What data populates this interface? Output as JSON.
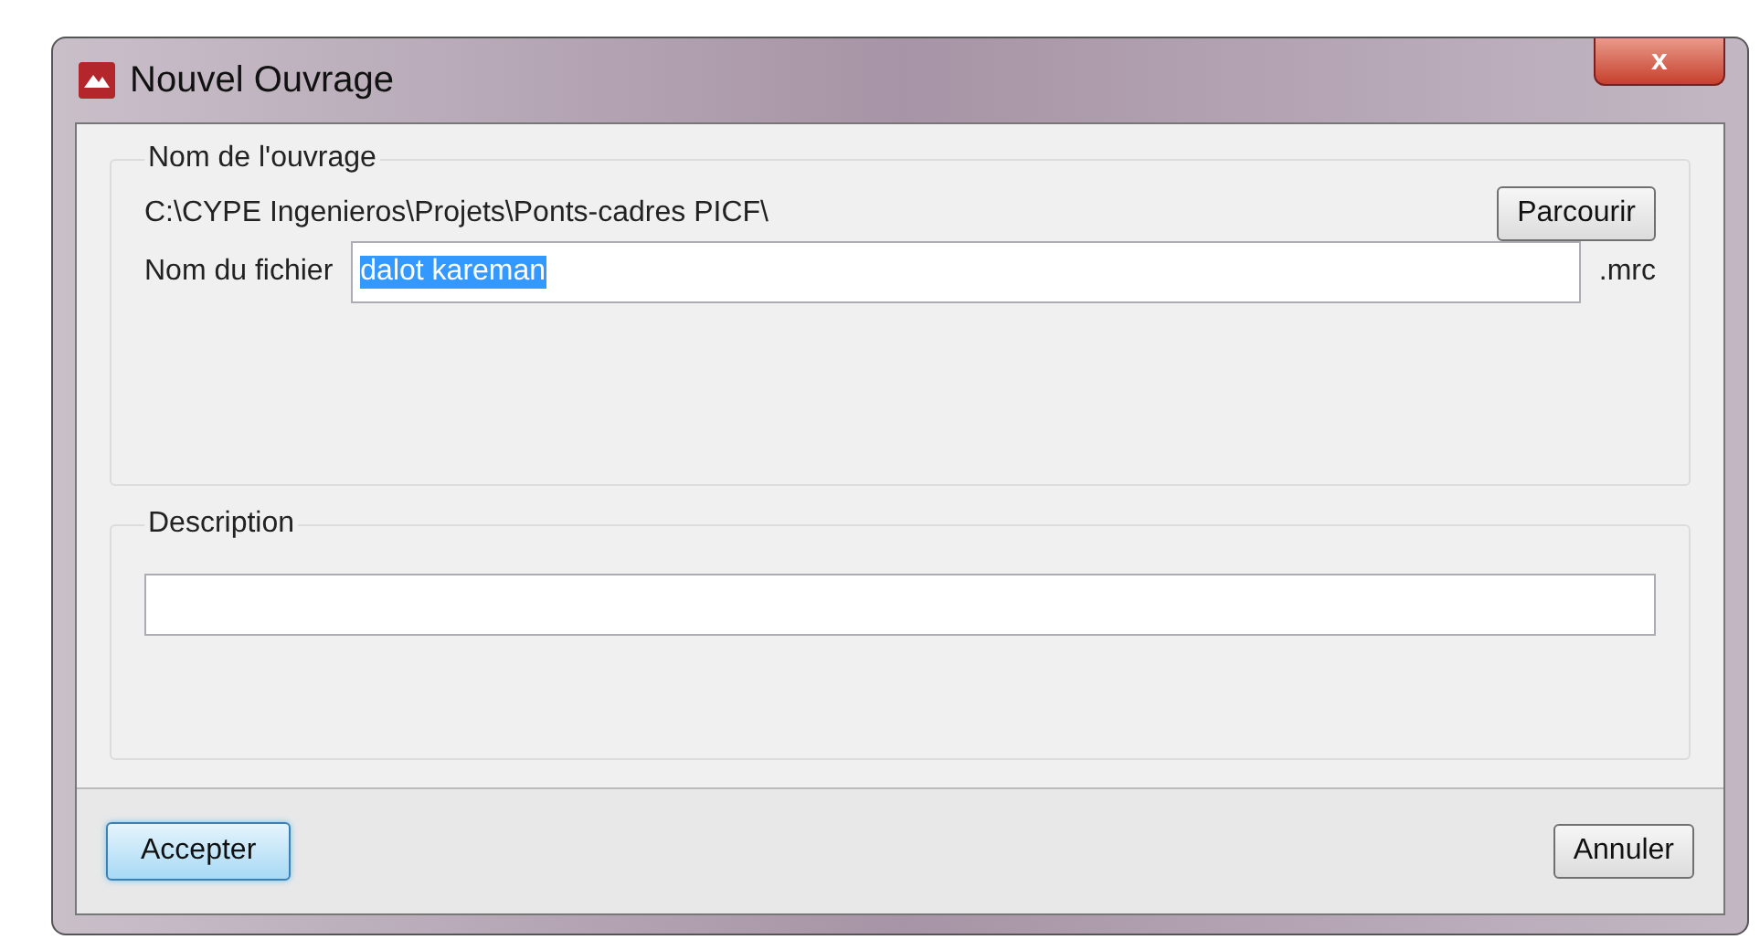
{
  "window": {
    "title": "Nouvel Ouvrage",
    "close": "x"
  },
  "name_group": {
    "title": "Nom de l'ouvrage",
    "path": "C:\\CYPE Ingenieros\\Projets\\Ponts-cadres PICF\\",
    "browse_button": "Parcourir",
    "file_label": "Nom du fichier",
    "file_value": "dalot kareman",
    "file_value_selected": true,
    "extension": ".mrc"
  },
  "description_group": {
    "title": "Description"
  },
  "buttons": [
    {
      "label": "Accepter",
      "default": true
    },
    {
      "label": "Annuler",
      "default": false
    }
  ]
}
